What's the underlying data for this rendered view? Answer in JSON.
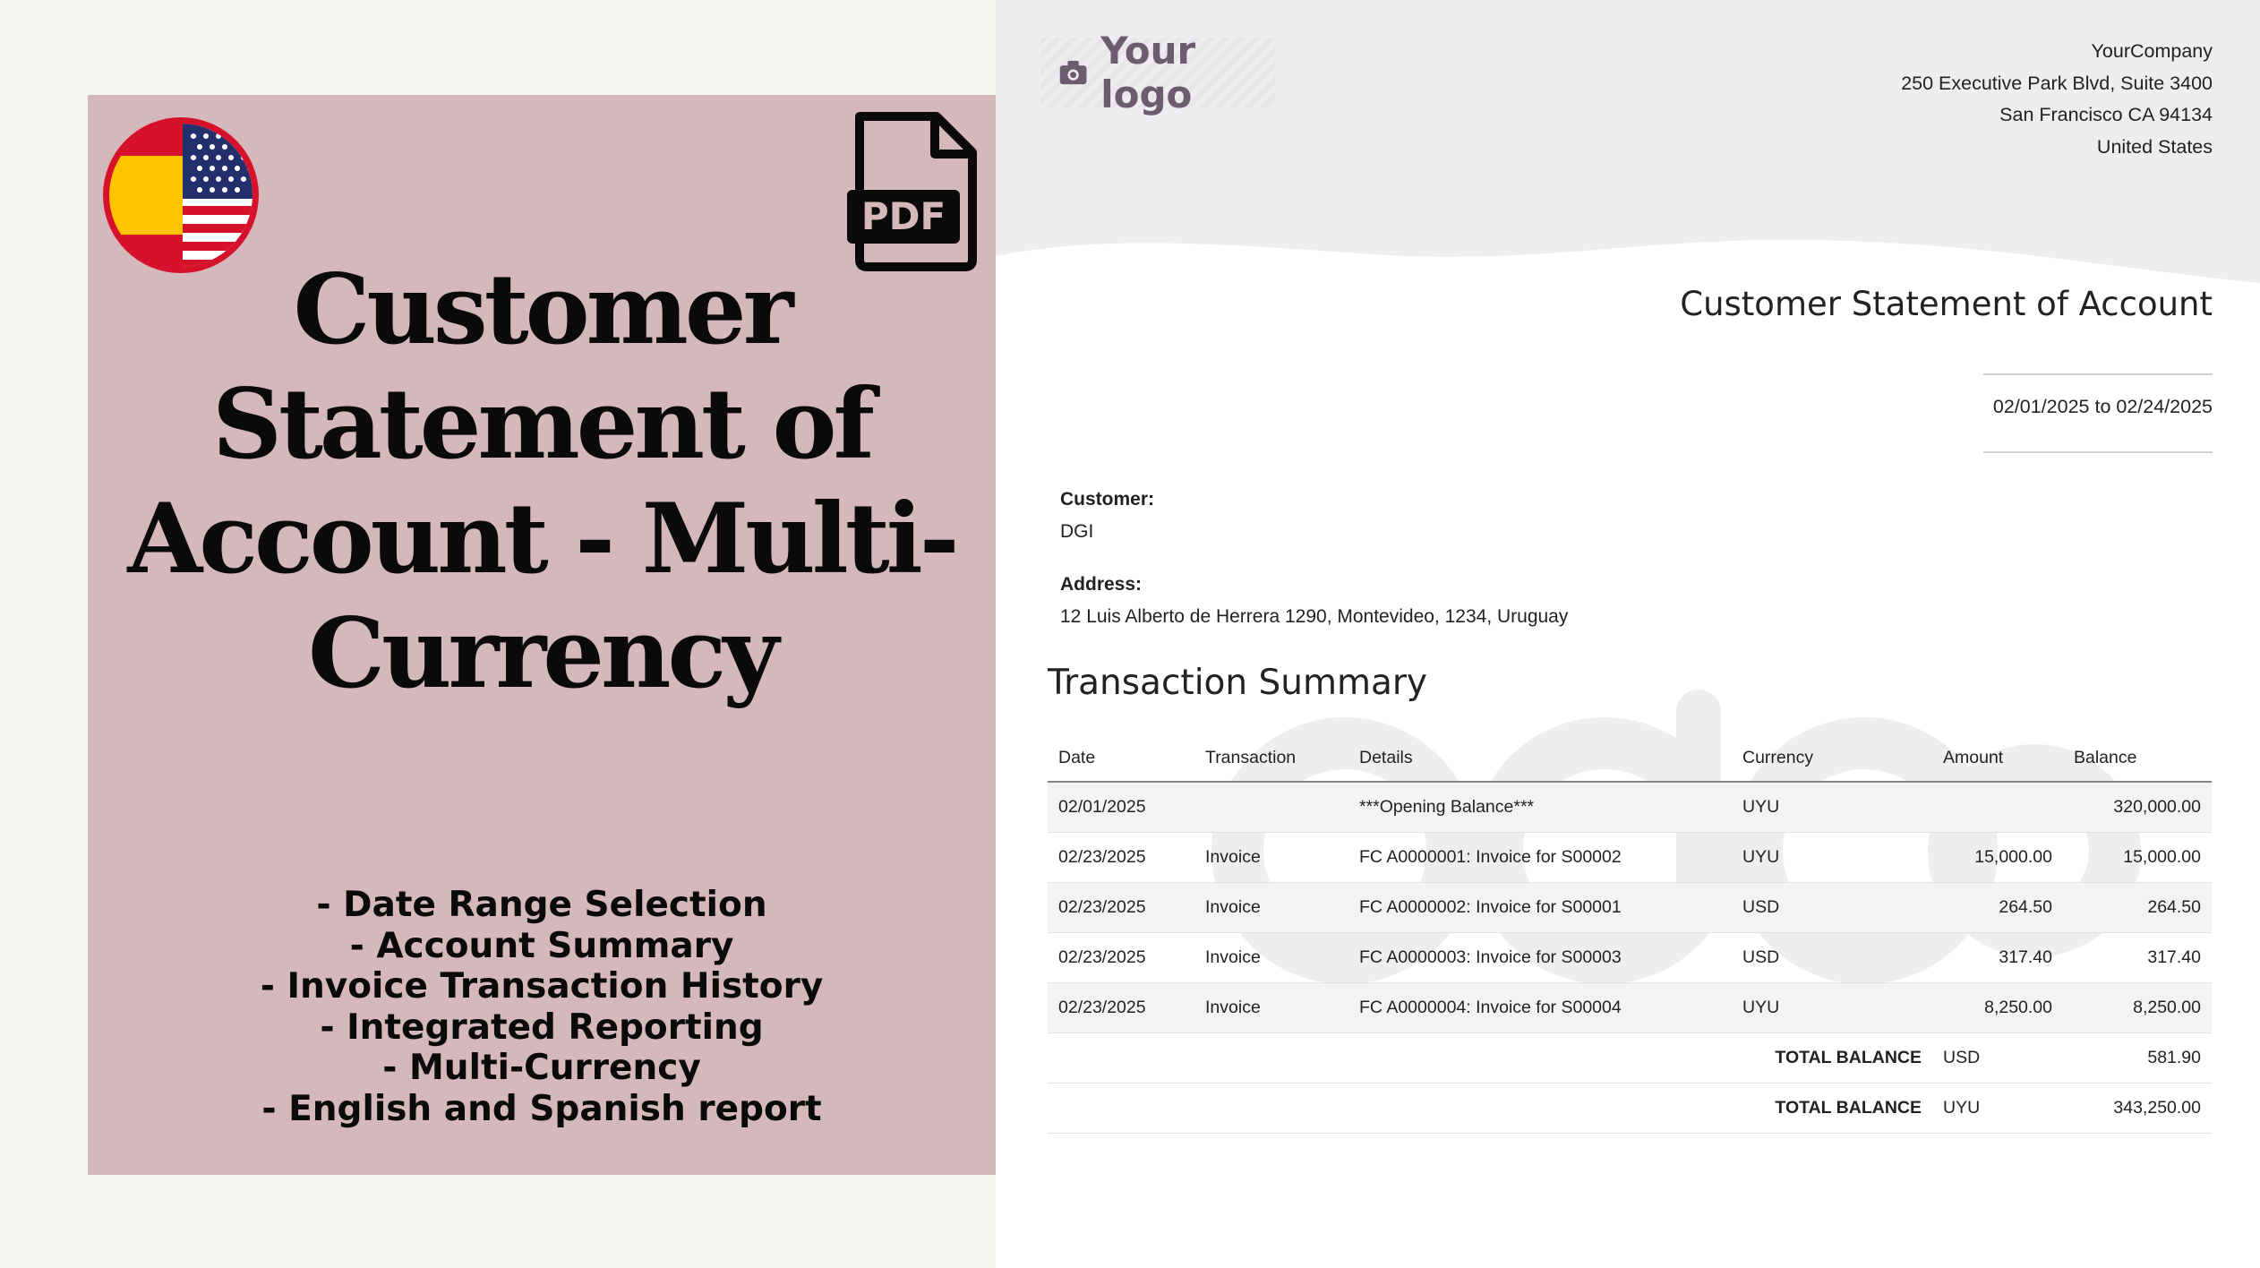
{
  "promo": {
    "title_lines": [
      "Customer",
      "Statement of",
      "Account - Multi-",
      "Currency"
    ],
    "pdf_label": "PDF",
    "features": [
      "- Date Range Selection",
      "- Account Summary",
      "- Invoice Transaction History",
      "- Integrated Reporting",
      "- Multi-Currency",
      "- English and Spanish report"
    ]
  },
  "colors": {
    "promo_bg": "#d4b8bb",
    "page_bg": "#f5f5f0",
    "header_bg": "#eeedf0",
    "logo_text": "#6d5b70"
  },
  "report": {
    "logo_text": "Your logo",
    "company": {
      "name": "YourCompany",
      "street": "250 Executive Park Blvd, Suite 3400",
      "city": "San Francisco CA 94134",
      "country": "United States"
    },
    "title": "Customer Statement of Account",
    "date_range": "02/01/2025 to 02/24/2025",
    "customer_label": "Customer:",
    "customer_value": "DGI",
    "address_label": "Address:",
    "address_value": "12 Luis Alberto de Herrera 1290, Montevideo, 1234, Uruguay",
    "section_title": "Transaction Summary",
    "watermark": "odoo",
    "table": {
      "headers": [
        "Date",
        "Transaction",
        "Details",
        "Currency",
        "Amount",
        "Balance"
      ],
      "rows": [
        [
          "02/01/2025",
          "",
          "***Opening Balance***",
          "UYU",
          "",
          "320,000.00"
        ],
        [
          "02/23/2025",
          "Invoice",
          "FC A0000001: Invoice for S00002",
          "UYU",
          "15,000.00",
          "15,000.00"
        ],
        [
          "02/23/2025",
          "Invoice",
          "FC A0000002: Invoice for S00001",
          "USD",
          "264.50",
          "264.50"
        ],
        [
          "02/23/2025",
          "Invoice",
          "FC A0000003: Invoice for S00003",
          "USD",
          "317.40",
          "317.40"
        ],
        [
          "02/23/2025",
          "Invoice",
          "FC A0000004: Invoice for S00004",
          "UYU",
          "8,250.00",
          "8,250.00"
        ]
      ],
      "totals": [
        {
          "label": "TOTAL BALANCE",
          "currency": "USD",
          "value": "581.90"
        },
        {
          "label": "TOTAL BALANCE",
          "currency": "UYU",
          "value": "343,250.00"
        }
      ]
    }
  }
}
